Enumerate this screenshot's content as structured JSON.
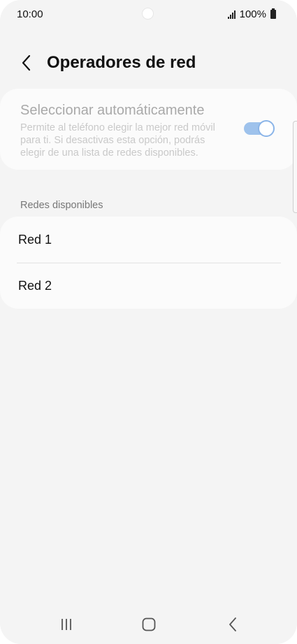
{
  "status_bar": {
    "time": "10:00",
    "battery": "100%"
  },
  "header": {
    "title": "Operadores de red"
  },
  "auto_select": {
    "title": "Seleccionar automáticamente",
    "description": "Permite al teléfono elegir la mejor red móvil para ti. Si desactivas esta opción, podrás elegir de una lista de redes disponibles.",
    "enabled": true
  },
  "available_networks": {
    "section_label": "Redes disponibles",
    "items": [
      {
        "label": "Red 1"
      },
      {
        "label": "Red 2"
      }
    ]
  },
  "colors": {
    "toggle_track": "#9ec2ec",
    "toggle_border": "#8ab4e8",
    "background": "#f4f4f4",
    "card": "#fbfbfb"
  },
  "icons": {
    "back": "chevron-left-icon",
    "signal": "signal-icon",
    "battery": "battery-icon",
    "nav_recent": "recent-apps-icon",
    "nav_home": "home-icon",
    "nav_back": "nav-back-icon"
  }
}
